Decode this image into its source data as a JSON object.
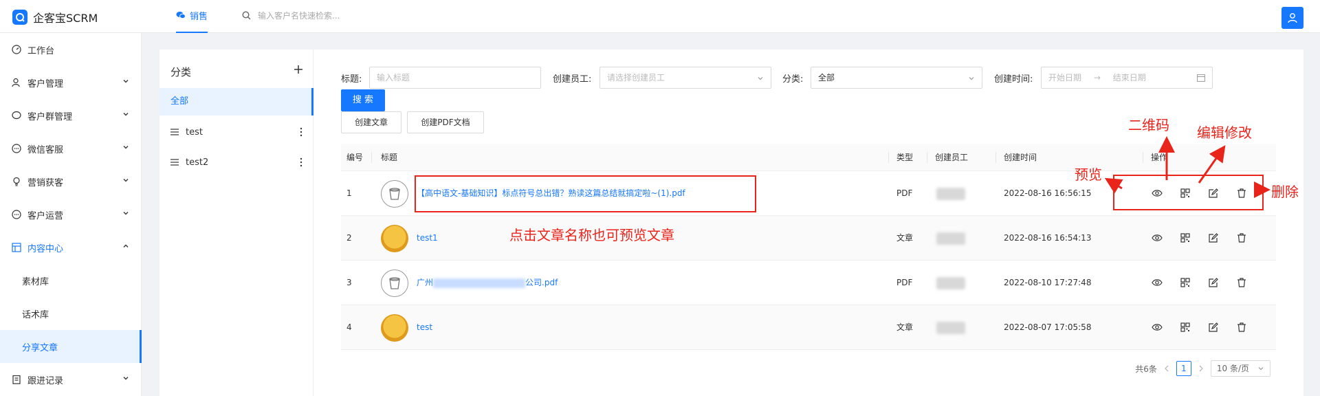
{
  "app": {
    "title": "企客宝SCRM"
  },
  "topnav": {
    "tab_label": "销售",
    "search_placeholder": "输入客户名快速检索..."
  },
  "sidebar": {
    "items": [
      {
        "label": "工作台"
      },
      {
        "label": "客户管理"
      },
      {
        "label": "客户群管理"
      },
      {
        "label": "微信客服"
      },
      {
        "label": "营销获客"
      },
      {
        "label": "客户运营"
      },
      {
        "label": "内容中心"
      },
      {
        "label": "跟进记录"
      }
    ],
    "subitems": [
      {
        "label": "素材库"
      },
      {
        "label": "话术库"
      },
      {
        "label": "分享文章"
      }
    ]
  },
  "category": {
    "title": "分类",
    "all_label": "全部",
    "items": [
      {
        "label": "test"
      },
      {
        "label": "test2"
      }
    ]
  },
  "filters": {
    "title_label": "标题:",
    "title_placeholder": "输入标题",
    "creator_label": "创建员工:",
    "creator_placeholder": "请选择创建员工",
    "category_label": "分类:",
    "category_value": "全部",
    "created_label": "创建时间:",
    "start_placeholder": "开始日期",
    "end_placeholder": "结束日期",
    "date_separator": "→"
  },
  "buttons": {
    "search": "搜 索",
    "create_article": "创建文章",
    "create_pdf": "创建PDF文档"
  },
  "table": {
    "headers": {
      "index": "编号",
      "title": "标题",
      "type": "类型",
      "creator": "创建员工",
      "created": "创建时间",
      "actions": "操作"
    },
    "rows": [
      {
        "index": "1",
        "title": "【高中语文-基础知识】标点符号总出错？熟读这篇总结就搞定啦~(1).pdf",
        "type": "PDF",
        "created": "2022-08-16 16:56:15",
        "thumb": "pdf"
      },
      {
        "index": "2",
        "title": "test1",
        "type": "文章",
        "created": "2022-08-16 16:54:13",
        "thumb": "img"
      },
      {
        "index": "3",
        "title_prefix": "广州",
        "title_suffix": "公司.pdf",
        "type": "PDF",
        "created": "2022-08-10 17:27:48",
        "thumb": "pdf"
      },
      {
        "index": "4",
        "title": "test",
        "type": "文章",
        "created": "2022-08-07 17:05:58",
        "thumb": "img"
      }
    ]
  },
  "pagination": {
    "total": "共6条",
    "current_page": "1",
    "page_size": "10 条/页"
  },
  "annotations": {
    "click_title": "点击文章名称也可预览文章",
    "preview": "预览",
    "qrcode": "二维码",
    "edit": "编辑修改",
    "delete": "删除",
    "color": "#e8241b"
  },
  "colors": {
    "accent": "#1677ff"
  }
}
